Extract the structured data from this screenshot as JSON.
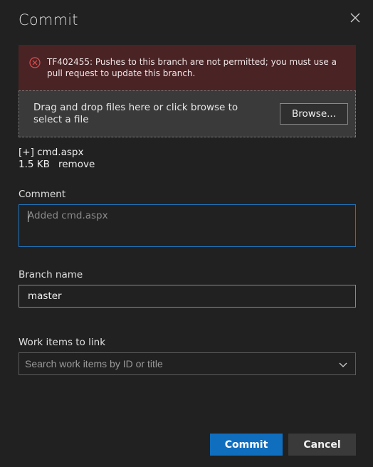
{
  "dialog": {
    "title": "Commit",
    "close_icon": "close-icon"
  },
  "error": {
    "icon": "error-circle-icon",
    "message": "TF402455: Pushes to this branch are not permitted; you must use a pull request to update this branch."
  },
  "upload": {
    "drop_text": "Drag and drop files here or click browse to select a file",
    "browse_label": "Browse..."
  },
  "file": {
    "name": "[+] cmd.aspx",
    "size": "1.5 KB",
    "remove_label": "remove"
  },
  "comment": {
    "label": "Comment",
    "value": "",
    "placeholder": "Added cmd.aspx"
  },
  "branch": {
    "label": "Branch name",
    "value": "master"
  },
  "work_items": {
    "label": "Work items to link",
    "placeholder": "Search work items by ID or title",
    "chevron_icon": "chevron-down-icon"
  },
  "actions": {
    "commit_label": "Commit",
    "cancel_label": "Cancel"
  },
  "colors": {
    "background": "#212121",
    "error_background": "#4a2325",
    "error_icon": "#e05050",
    "primary_button": "#106ebe",
    "focus_border": "#1f76c2"
  }
}
